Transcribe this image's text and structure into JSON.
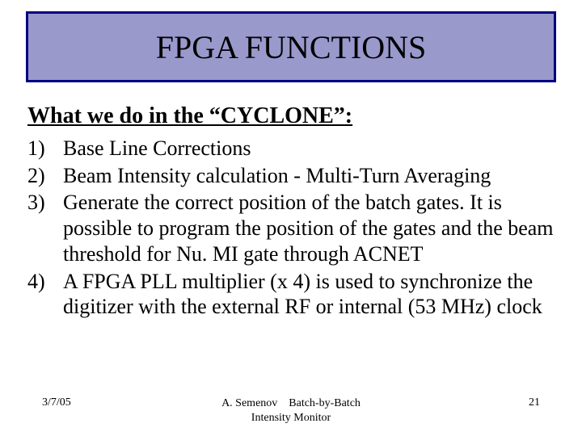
{
  "title": "FPGA FUNCTIONS",
  "heading": "What we do in the  “CYCLONE”:",
  "items": [
    {
      "num": "1)",
      "text": "Base Line Corrections"
    },
    {
      "num": "2)",
      "text": "Beam Intensity calculation - Multi-Turn Averaging"
    },
    {
      "num": "3)",
      "text": "Generate the correct position of the batch gates. It is possible to program the position of the gates and the beam threshold for Nu. MI gate  through ACNET"
    },
    {
      "num": "4)",
      "text": "A FPGA  PLL multiplier (x 4) is used to synchronize the digitizer with the external RF or internal (53 MHz) clock"
    }
  ],
  "footer": {
    "date": "3/7/05",
    "center_line1": "A. Semenov    Batch-by-Batch",
    "center_line2": "Intensity Monitor",
    "page": "21"
  }
}
